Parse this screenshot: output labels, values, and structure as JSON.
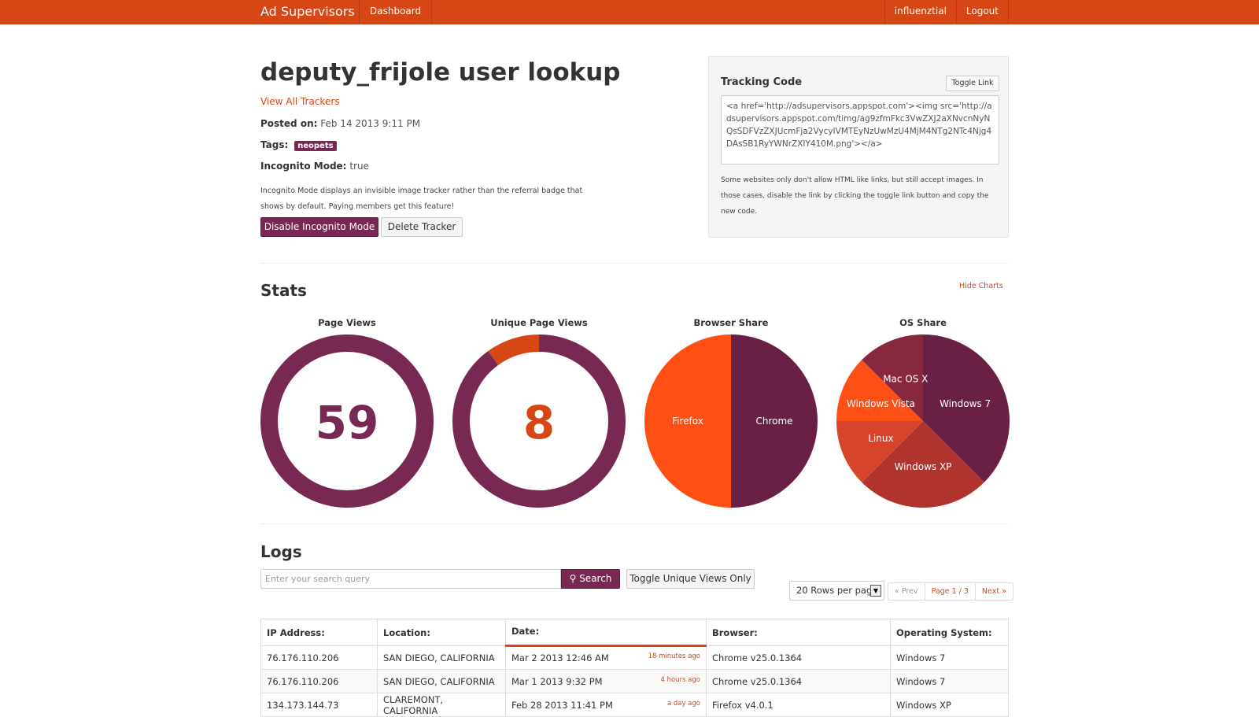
{
  "nav": {
    "brand": "Ad Supervisors",
    "dashboard": "Dashboard",
    "user": "influenztial",
    "logout": "Logout"
  },
  "header": {
    "title": "deputy_frijole user lookup",
    "view_all": "View All Trackers",
    "posted_label": "Posted on:",
    "posted_value": "Feb 14 2013 9:11 PM",
    "tags_label": "Tags:",
    "tag": "neopets",
    "incognito_label": "Incognito Mode:",
    "incognito_value": "true",
    "incognito_note": "Incognito Mode displays an invisible image tracker rather than the referral badge that shows by default. Paying members get this feature!",
    "disable_button": "Disable Incognito Mode",
    "delete_button": "Delete Tracker"
  },
  "tracking": {
    "title": "Tracking Code",
    "toggle_button": "Toggle Link",
    "code": "<a href='http://adsupervisors.appspot.com'><img src='http://adsupervisors.appspot.com/timg/ag9zfmFkc3VwZXJ2aXNvcnNyNQsSDFVzZXJUcmFja2VycyIVMTEyNzUwMzU4MjM4NTg2NTc4Njg4DAsSB1RyYWNrZXIY410M.png'></a>",
    "note": "Some websites only don't allow HTML like links, but still accept images. In those cases, disable the link by clicking the toggle link button and copy the new code."
  },
  "stats": {
    "title": "Stats",
    "hide_charts": "Hide Charts"
  },
  "chart_data": [
    {
      "type": "pie",
      "title": "Page Views",
      "value": "59",
      "display": "donut",
      "colors": [
        "#772953"
      ]
    },
    {
      "type": "pie",
      "title": "Unique Page Views",
      "value": "8",
      "display": "donut",
      "slices": [
        {
          "label": "",
          "value": 0.9
        },
        {
          "label": "",
          "value": 0.1
        }
      ],
      "colors": [
        "#772953",
        "#d74716"
      ]
    },
    {
      "type": "pie",
      "title": "Browser Share",
      "slices": [
        {
          "label": "Chrome",
          "value": 50
        },
        {
          "label": "Firefox",
          "value": 50
        }
      ],
      "colors": [
        "#6a1f45",
        "#fe4f14"
      ]
    },
    {
      "type": "pie",
      "title": "OS Share",
      "slices": [
        {
          "label": "Windows 7",
          "value": 37.5
        },
        {
          "label": "Windows XP",
          "value": 25
        },
        {
          "label": "Linux",
          "value": 12.5
        },
        {
          "label": "Windows Vista",
          "value": 12.5
        },
        {
          "label": "Mac OS X",
          "value": 12.5
        }
      ],
      "colors": [
        "#6a1f45",
        "#b0332e",
        "#d8432c",
        "#fe4f14",
        "#87283f"
      ]
    }
  ],
  "logs": {
    "title": "Logs",
    "search_placeholder": "Enter your search query",
    "search_button": "Search",
    "toggle_unique": "Toggle Unique Views Only",
    "rows_per_page": "20 Rows per pag",
    "pager": {
      "prev": "« Prev",
      "page": "Page 1 / 3",
      "next": "Next »"
    },
    "columns": [
      "IP Address:",
      "Location:",
      "Date:",
      "Browser:",
      "Operating System:"
    ],
    "rows": [
      {
        "ip": "76.176.110.206",
        "location": "SAN DIEGO, CALIFORNIA",
        "date": "Mar 2 2013 12:46 AM",
        "ago": "18 minutes ago",
        "browser": "Chrome v25.0.1364",
        "os": "Windows 7"
      },
      {
        "ip": "76.176.110.206",
        "location": "SAN DIEGO, CALIFORNIA",
        "date": "Mar 1 2013 9:32 PM",
        "ago": "4 hours ago",
        "browser": "Chrome v25.0.1364",
        "os": "Windows 7"
      },
      {
        "ip": "134.173.144.73",
        "location": "CLAREMONT, CALIFORNIA",
        "date": "Feb 28 2013 11:41 PM",
        "ago": "a day ago",
        "browser": "Firefox v4.0.1",
        "os": "Windows XP"
      }
    ]
  }
}
